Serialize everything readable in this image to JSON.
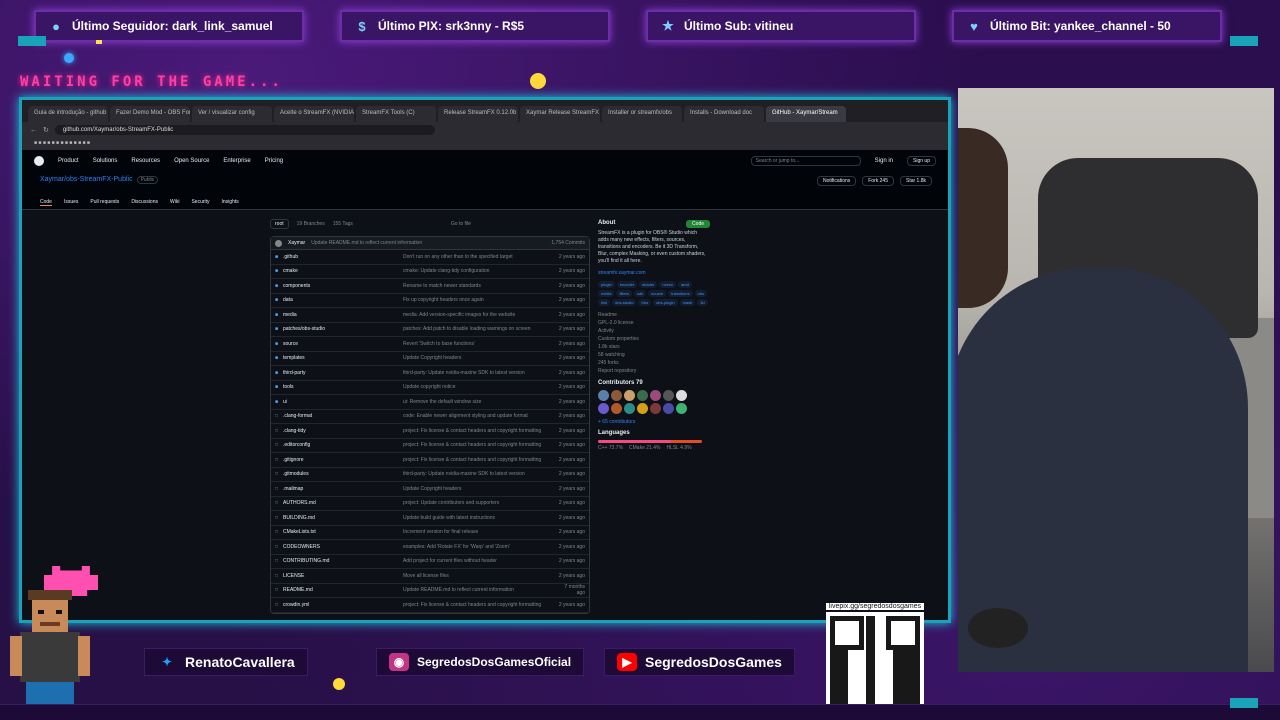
{
  "alerts": [
    {
      "icon": "user-icon",
      "text": "Último Seguidor: dark_link_samuel"
    },
    {
      "icon": "dollar-icon",
      "text": "Último PIX: srk3nny - R$5"
    },
    {
      "icon": "star-icon",
      "text": "Último Sub: vitineu"
    },
    {
      "icon": "heart-icon",
      "text": "Último Bit: yankee_channel - 50"
    }
  ],
  "waiting_text": "WAITING FOR THE GAME...",
  "browser": {
    "tabs": [
      "Guia de introdução - github",
      "Fazer Demo Mod - OBS Forums",
      "Ver / visualizar config",
      "Aceite o StreamFX (NVIDIA)",
      "StreamFX Tools (C)",
      "Release StreamFX 0.12.0b",
      "Xaymar Release StreamFX",
      "Installer or streamfx/obs",
      "Installs - Download doc",
      "GitHub - Xaymar/Stream"
    ],
    "active_tab": 9,
    "url": "github.com/Xaymar/obs-StreamFX-Public"
  },
  "github": {
    "nav": [
      "Product",
      "Solutions",
      "Resources",
      "Open Source",
      "Enterprise",
      "Pricing"
    ],
    "search_placeholder": "Search or jump to...",
    "sign_in": "Sign in",
    "sign_up": "Sign up",
    "repo_name": "Xaymar/obs-StreamFX-Public",
    "visibility": "Public",
    "repo_actions": [
      "Notifications",
      "Fork 245",
      "Star 1.8k"
    ],
    "repo_nav": [
      "Code",
      "Issues",
      "Pull requests",
      "Discussions",
      "Wiki",
      "Security",
      "Insights"
    ],
    "branch": "root",
    "branches": "19 Branches",
    "tags": "155 Tags",
    "go_to_file": "Go to file",
    "code_button": "Code",
    "commit": {
      "author": "Xaymar",
      "message": "Update README.md to reflect current information",
      "commits": "1,754 Commits"
    },
    "files": [
      {
        "icon": "dir",
        "name": ".github",
        "msg": "Don't run on any other than to the specified target",
        "age": "2 years ago"
      },
      {
        "icon": "dir",
        "name": "cmake",
        "msg": "cmake: Update clang-tidy configuration",
        "age": "2 years ago"
      },
      {
        "icon": "dir",
        "name": "components",
        "msg": "Rename to match newer standards",
        "age": "2 years ago"
      },
      {
        "icon": "dir",
        "name": "data",
        "msg": "Fix up copyright headers once again",
        "age": "2 years ago"
      },
      {
        "icon": "dir",
        "name": "media",
        "msg": "media: Add version-specific images for the website",
        "age": "2 years ago"
      },
      {
        "icon": "dir",
        "name": "patches/obs-studio",
        "msg": "patches: Add patch to disable loading warnings on screen",
        "age": "2 years ago"
      },
      {
        "icon": "dir",
        "name": "source",
        "msg": "Revert 'Switch to base functions'",
        "age": "2 years ago"
      },
      {
        "icon": "dir",
        "name": "templates",
        "msg": "Update Copyright headers",
        "age": "2 years ago"
      },
      {
        "icon": "dir",
        "name": "third-party",
        "msg": "third-party: Update nvidia-maxine SDK to latest version",
        "age": "2 years ago"
      },
      {
        "icon": "dir",
        "name": "tools",
        "msg": "Update copyright notice",
        "age": "2 years ago"
      },
      {
        "icon": "dir",
        "name": "ui",
        "msg": "ui: Remove the default window size",
        "age": "2 years ago"
      },
      {
        "icon": "file",
        "name": ".clang-format",
        "msg": "code: Enable newer alignment styling and update format",
        "age": "2 years ago"
      },
      {
        "icon": "file",
        "name": ".clang-tidy",
        "msg": "project: Fix license & contact headers and copyright formatting",
        "age": "2 years ago"
      },
      {
        "icon": "file",
        "name": ".editorconfig",
        "msg": "project: Fix license & contact headers and copyright formatting",
        "age": "2 years ago"
      },
      {
        "icon": "file",
        "name": ".gitignore",
        "msg": "project: Fix license & contact headers and copyright formatting",
        "age": "2 years ago"
      },
      {
        "icon": "file",
        "name": ".gitmodules",
        "msg": "third-party: Update nvidia-maxine SDK to latest version",
        "age": "2 years ago"
      },
      {
        "icon": "file",
        "name": ".mailmap",
        "msg": "Update Copyright headers",
        "age": "2 years ago"
      },
      {
        "icon": "file",
        "name": "AUTHORS.md",
        "msg": "project: Update contributors and supporters",
        "age": "2 years ago"
      },
      {
        "icon": "file",
        "name": "BUILDING.md",
        "msg": "Update build guide with latest instructions",
        "age": "2 years ago"
      },
      {
        "icon": "file",
        "name": "CMakeLists.txt",
        "msg": "Increment version for final release",
        "age": "2 years ago"
      },
      {
        "icon": "file",
        "name": "CODEOWNERS",
        "msg": "examples: Add 'Rotate FX' for 'Warp' and 'Zoom'",
        "age": "2 years ago"
      },
      {
        "icon": "file",
        "name": "CONTRIBUTING.md",
        "msg": "Add project for current files without header",
        "age": "2 years ago"
      },
      {
        "icon": "file",
        "name": "LICENSE",
        "msg": "Move all license files",
        "age": "2 years ago"
      },
      {
        "icon": "file",
        "name": "README.md",
        "msg": "Update README.md to reflect current information",
        "age": "7 months ago"
      },
      {
        "icon": "file",
        "name": "crowdin.yml",
        "msg": "project: Fix license & contact headers and copyright formatting",
        "age": "2 years ago"
      }
    ],
    "about": {
      "title": "About",
      "description": "StreamFX is a plugin for OBS® Studio which adds many new effects, filters, sources, transitions and encoders. Be it 3D Transform, Blur, complex Masking, or even custom shaders, you'll find it all here.",
      "link": "streamfx.xaymar.com",
      "topics": [
        "plugin",
        "encoder",
        "shader",
        "nvenc",
        "amd",
        "nvidia",
        "filters",
        "sdk",
        "source",
        "transitions",
        "obs",
        "hlsl",
        "obs-studio",
        "blur",
        "obs-plugin",
        "mask",
        "3d"
      ],
      "meta": [
        "Readme",
        "GPL-2.0 license",
        "Activity",
        "Custom properties",
        "1.8k stars",
        "58 watching",
        "245 forks",
        "Report repository"
      ],
      "contributors_title": "Contributors 79",
      "contributors_more": "+ 65 contributors",
      "languages_title": "Languages",
      "languages": [
        "C++ 73.7%",
        "CMake 21.4%",
        "HLSL 4.9%"
      ]
    }
  },
  "social": [
    {
      "icon": "twitter-icon",
      "text": "RenatoCavallera",
      "color": "#1da1f2"
    },
    {
      "icon": "instagram-icon",
      "text": "SegredosDosGamesOficial",
      "color": "#c13584"
    },
    {
      "icon": "youtube-icon",
      "text": "SegredosDosGames",
      "color": "#ff0000"
    }
  ],
  "qr_label": "livepix.gg/segredosdosgames",
  "colors": {
    "frame": "#18a3b8",
    "accent_pink": "#ff3fa4",
    "bg": "#2a0f4a"
  }
}
